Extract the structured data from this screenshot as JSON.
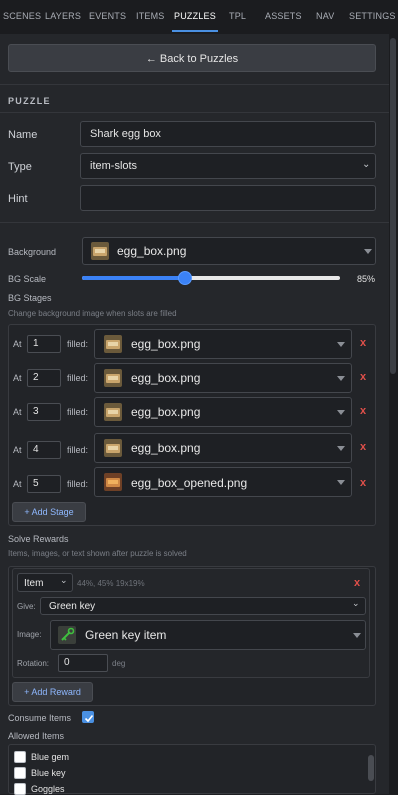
{
  "tabs": [
    "SCENES",
    "LAYERS",
    "EVENTS",
    "ITEMS",
    "PUZZLES",
    "TPL",
    "ASSETS",
    "NAV",
    "SETTINGS"
  ],
  "active_tab": "PUZZLES",
  "back_button": "← Back to Puzzles",
  "section_title": "PUZZLE",
  "form": {
    "name_label": "Name",
    "name_value": "Shark egg box",
    "type_label": "Type",
    "type_value": "item-slots",
    "hint_label": "Hint",
    "hint_value": ""
  },
  "background": {
    "label": "Background",
    "value": "egg_box.png",
    "scale_label": "BG Scale",
    "scale_value": "85%",
    "scale_fraction": 0.4
  },
  "stages": {
    "title": "BG Stages",
    "subtitle": "Change background image when slots are filled",
    "at_label": "At",
    "filled_label": "filled:",
    "remove": "x",
    "items": [
      {
        "count": "1",
        "image": "egg_box.png"
      },
      {
        "count": "2",
        "image": "egg_box.png"
      },
      {
        "count": "3",
        "image": "egg_box.png"
      },
      {
        "count": "4",
        "image": "egg_box.png"
      },
      {
        "count": "5",
        "image": "egg_box_opened.png"
      }
    ],
    "add_button": "+ Add Stage"
  },
  "rewards": {
    "title": "Solve Rewards",
    "subtitle": "Items, images, or text shown after puzzle is solved",
    "type_value": "Item",
    "position_text": "44%, 45% 19x19%",
    "remove": "x",
    "give_label": "Give:",
    "give_value": "Green key",
    "image_label": "Image:",
    "image_value": "Green key item",
    "rotation_label": "Rotation:",
    "rotation_value": "0",
    "rotation_unit": "deg",
    "add_button": "+ Add Reward"
  },
  "consume": {
    "label": "Consume Items",
    "checked": true
  },
  "allowed": {
    "title": "Allowed Items",
    "items": [
      "Blue gem",
      "Blue key",
      "Goggles"
    ]
  },
  "colors": {
    "accent": "#4a90e2",
    "danger": "#e0504a",
    "background": "#25272b"
  }
}
